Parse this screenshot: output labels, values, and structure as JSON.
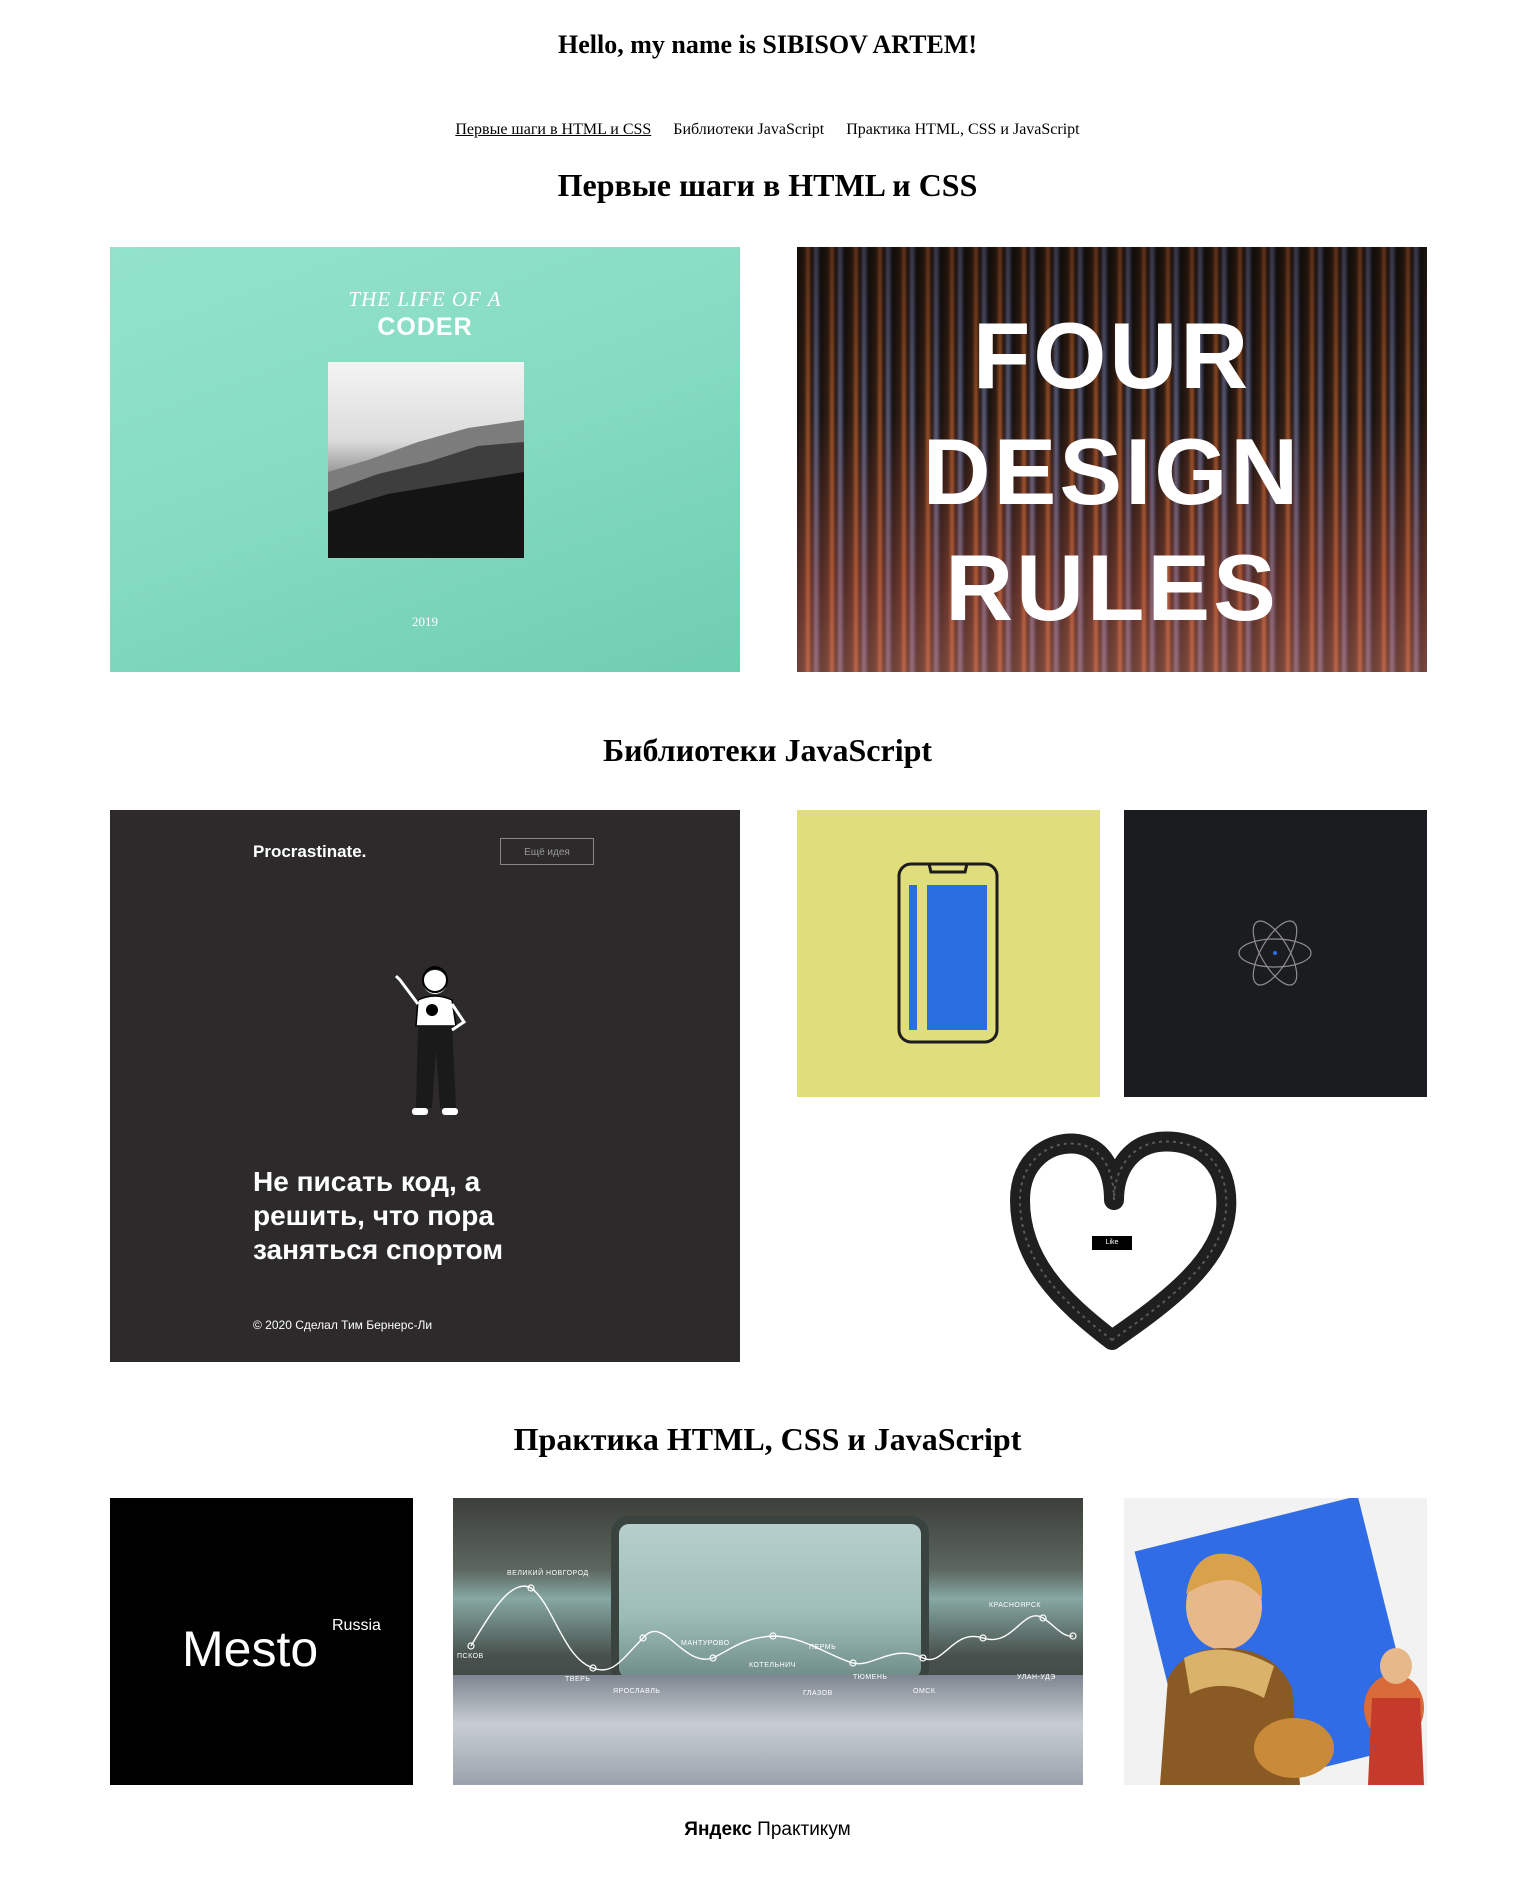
{
  "header": {
    "greeting": "Hello, my name is SIBISOV ARTEM!"
  },
  "nav": {
    "items": [
      {
        "label": "Первые шаги в HTML и CSS",
        "active": true
      },
      {
        "label": "Библиотеки JavaScript",
        "active": false
      },
      {
        "label": "Практика HTML, CSS и JavaScript",
        "active": false
      }
    ]
  },
  "sections": [
    {
      "title": "Первые шаги в HTML и CSS",
      "projects": [
        {
          "name": "life-of-a-coder",
          "line1": "THE LIFE OF A",
          "line2": "CODER",
          "year": "2019"
        },
        {
          "name": "four-design-rules",
          "words": [
            "FOUR",
            "DESIGN",
            "RULES"
          ]
        }
      ]
    },
    {
      "title": "Библиотеки JavaScript",
      "projects": [
        {
          "name": "procrastinate",
          "logo": "Procrastinate.",
          "button": "Ещё идея",
          "quote": [
            "Не писать код, а",
            "решить, что пора",
            "заняться спортом"
          ],
          "copyright": "© 2020 Сделал Тим Бернерс-Ли"
        },
        {
          "name": "phone-animation"
        },
        {
          "name": "atom-animation"
        },
        {
          "name": "heart-like",
          "button": "Like"
        }
      ]
    },
    {
      "title": "Практика HTML, CSS и JavaScript",
      "projects": [
        {
          "name": "mesto",
          "title": "Mesto",
          "subtitle": "Russia"
        },
        {
          "name": "russian-travel",
          "cities": [
            "ВЕЛИКИЙ НОВГОРОД",
            "ПСКОВ",
            "ТВЕРЬ",
            "ЯРОСЛАВЛЬ",
            "МАНТУРОВО",
            "КОТЕЛЬНИЧ",
            "ГЛАЗОВ",
            "ПЕРМЬ",
            "ТЮМЕНЬ",
            "ОМСК",
            "КРАСНОЯРСК",
            "УЛАН-УДЭ"
          ]
        },
        {
          "name": "boy-painting"
        }
      ]
    }
  ],
  "footer": {
    "brand": "Яндекс",
    "product": "Практикум"
  },
  "colors": {
    "coder_bg": "#8ee0c8",
    "procrastinate_bg": "#2d2a2b",
    "phone_bg": "#e0dd7c",
    "phone_screen": "#2a6ee2",
    "atom_bg": "#1b1c20",
    "mesto_bg": "#000000",
    "boy_blue": "#2f6ce6"
  }
}
